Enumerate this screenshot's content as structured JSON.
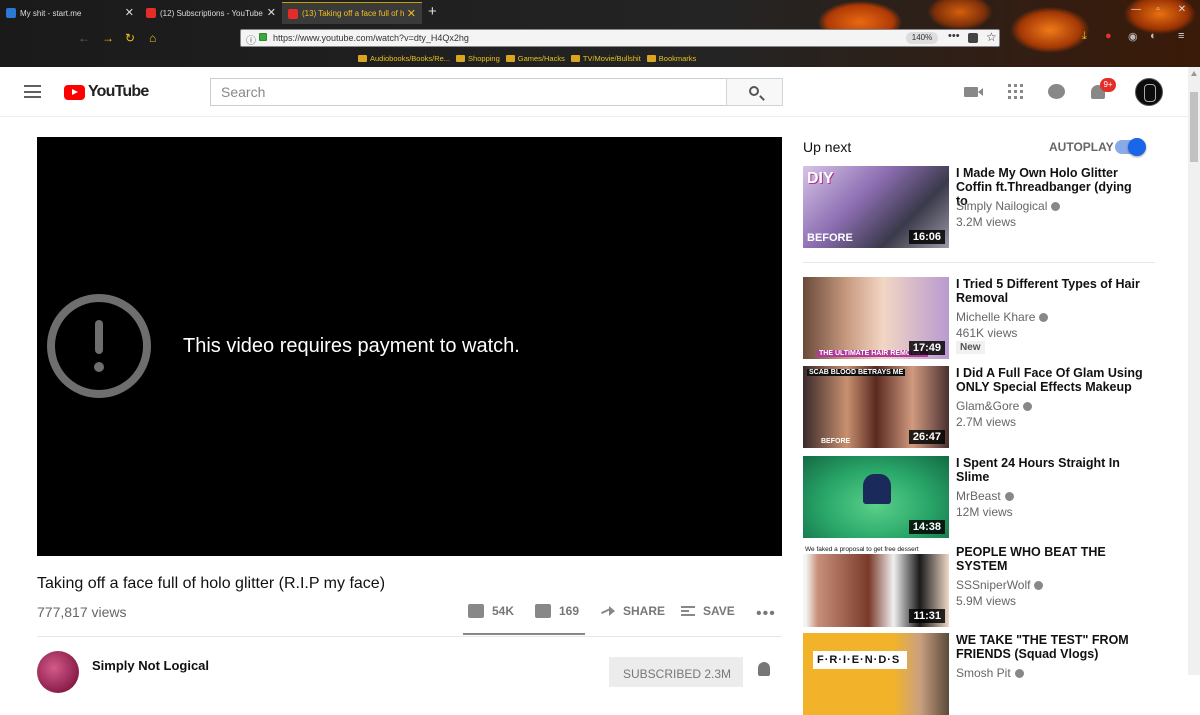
{
  "browser": {
    "tabs": [
      {
        "label": "My shit - start.me"
      },
      {
        "label": "(12) Subscriptions - YouTube"
      },
      {
        "label": "(13) Taking off a face full of h"
      }
    ],
    "url": "https://www.youtube.com/watch?v=dty_H4Qx2hg",
    "zoom": "140%",
    "bookmarks": [
      "Audiobooks/Books/Re...",
      "Shopping",
      "Games/Hacks",
      "TV/Movie/Bullshit",
      "Bookmarks"
    ],
    "accent_color": "#e8c21c"
  },
  "masthead": {
    "logo_text": "YouTube",
    "search_placeholder": "Search",
    "notification_count": "9+",
    "brand_color": "#ff0000"
  },
  "player": {
    "error_message": "This video requires payment to watch."
  },
  "video": {
    "title": "Taking off a face full of holo glitter (R.I.P my face)",
    "views": "777,817 views",
    "likes": "54K",
    "dislikes": "169",
    "share_label": "SHARE",
    "save_label": "SAVE",
    "more_label": "•••",
    "channel": "Simply Not Logical",
    "subscribe_label": "SUBSCRIBED 2.3M"
  },
  "sidebar": {
    "up_next_label": "Up next",
    "autoplay_label": "AUTOPLAY",
    "autoplay_on": true,
    "items": [
      {
        "title": "I Made My Own Holo Glitter Coffin ft.Threadbanger (dying to",
        "channel": "Simply Nailogical",
        "views": "3.2M views",
        "duration": "16:06",
        "thumb_caption": "BEFORE",
        "badge": ""
      },
      {
        "title": "I Tried 5 Different Types of Hair Removal",
        "channel": "Michelle Khare",
        "views": "461K views",
        "duration": "17:49",
        "thumb_caption": "THE ULTIMATE HAIR REMOVA...",
        "badge": "New"
      },
      {
        "title": "I Did A Full Face Of Glam Using ONLY Special Effects Makeup",
        "channel": "Glam&Gore",
        "views": "2.7M views",
        "duration": "26:47",
        "thumb_caption": "SCAB BLOOD BETRAYS ME",
        "badge": ""
      },
      {
        "title": "I Spent 24 Hours Straight In Slime",
        "channel": "MrBeast",
        "views": "12M views",
        "duration": "14:38",
        "thumb_caption": "",
        "badge": ""
      },
      {
        "title": "PEOPLE WHO BEAT THE SYSTEM",
        "channel": "SSSniperWolf",
        "views": "5.9M views",
        "duration": "11:31",
        "thumb_caption": "We faked a proposal to get free dessert",
        "badge": ""
      },
      {
        "title": "WE TAKE \"THE TEST\" FROM FRIENDS (Squad Vlogs)",
        "channel": "Smosh Pit",
        "views": "",
        "duration": "",
        "thumb_caption": "F·R·I·E·N·D·S",
        "badge": ""
      }
    ]
  }
}
